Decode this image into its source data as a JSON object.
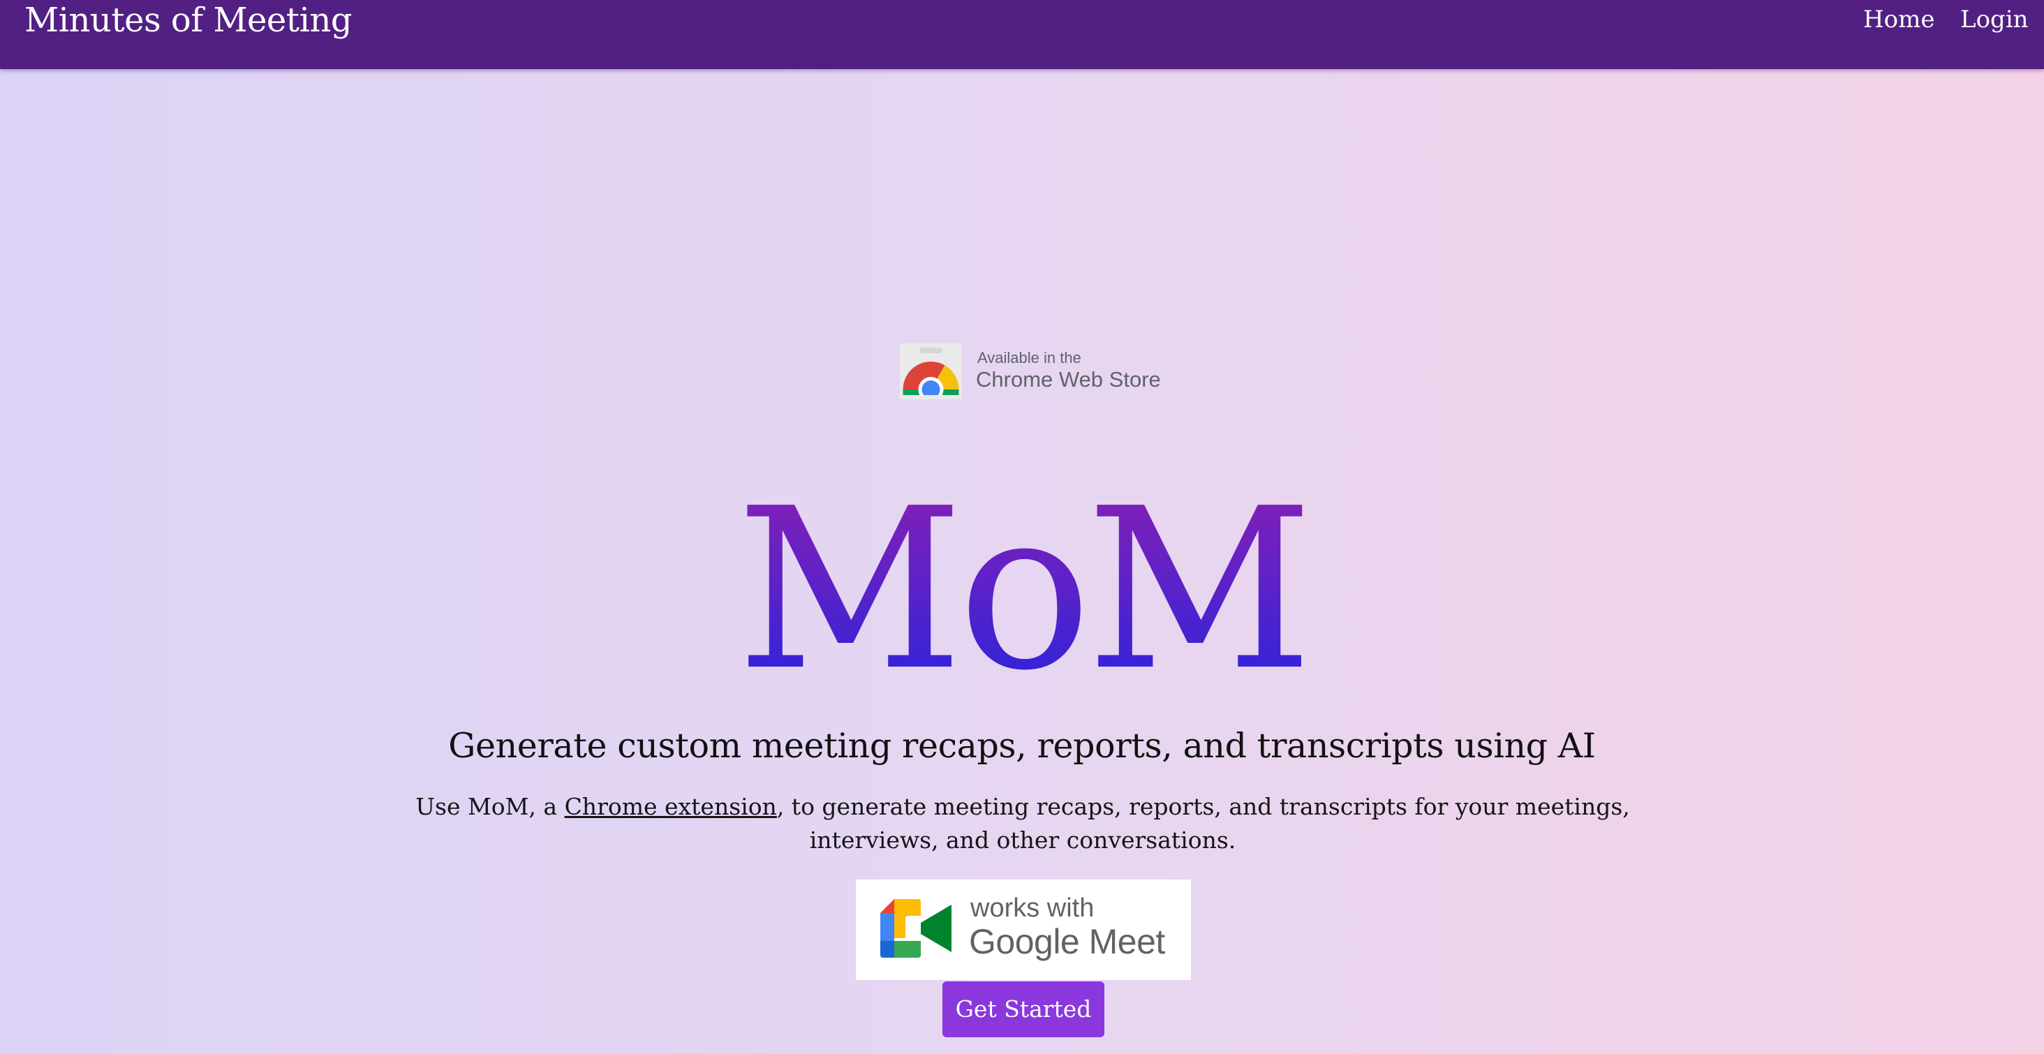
{
  "nav": {
    "brand": "Minutes of Meeting",
    "links": [
      {
        "label": "Home"
      },
      {
        "label": "Login"
      }
    ]
  },
  "chrome_badge": {
    "small_text": "Available in the",
    "big_text": "Chrome Web Store",
    "icon": "chrome-web-store-icon"
  },
  "hero": {
    "title": "MoM",
    "subtitle": "Generate custom meeting recaps, reports, and transcripts using AI",
    "description_before": "Use MoM, a ",
    "description_link": "Chrome extension",
    "description_after": ", to generate meeting recaps, reports, and transcripts for your meetings, interviews, and other conversations."
  },
  "meet_badge": {
    "small_text": "works with",
    "big_text": "Google Meet",
    "icon": "google-meet-icon"
  },
  "cta": {
    "label": "Get Started"
  },
  "colors": {
    "navbar": "#522083",
    "cta": "#8a38de",
    "title_gradient_top": "#8a1fb3",
    "title_gradient_bottom": "#2424df"
  }
}
